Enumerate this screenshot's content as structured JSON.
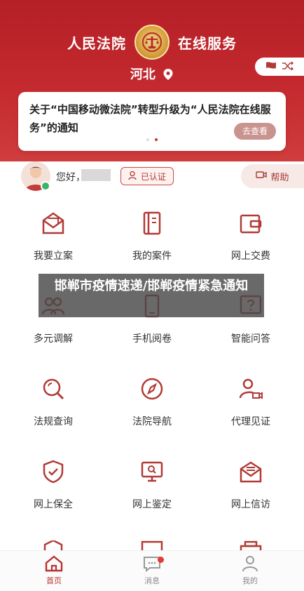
{
  "header": {
    "left_title": "人民法院",
    "right_title": "在线服务",
    "location": "河北",
    "emblem_icon": "court-emblem-icon",
    "switch_icons": [
      "flag-icon",
      "shuffle-icon"
    ]
  },
  "notice": {
    "text": "关于“中国移动微法院”转型升级为“人民法院在线服务”的通知",
    "button": "去查看",
    "pager_total": 2,
    "pager_active": 1
  },
  "user": {
    "greeting": "您好，",
    "auth_label": "已认证",
    "help_label": "帮助"
  },
  "grid": [
    {
      "label": "我要立案",
      "icon": "envelope-file-icon"
    },
    {
      "label": "我的案件",
      "icon": "folder-case-icon"
    },
    {
      "label": "网上交费",
      "icon": "wallet-icon"
    },
    {
      "label": "多元调解",
      "icon": "people-mediation-icon"
    },
    {
      "label": "手机阅卷",
      "icon": "phone-document-icon"
    },
    {
      "label": "智能问答",
      "icon": "question-bubble-icon"
    },
    {
      "label": "法规查询",
      "icon": "search-icon"
    },
    {
      "label": "法院导航",
      "icon": "compass-icon"
    },
    {
      "label": "代理见证",
      "icon": "agent-video-icon"
    },
    {
      "label": "网上保全",
      "icon": "shield-check-icon"
    },
    {
      "label": "网上鉴定",
      "icon": "monitor-search-icon"
    },
    {
      "label": "网上信访",
      "icon": "letter-icon"
    }
  ],
  "overlay_caption": "邯郸市疫情速递/邯郸疫情紧急通知",
  "tabbar": [
    {
      "label": "首页",
      "icon": "home-icon",
      "active": true
    },
    {
      "label": "消息",
      "icon": "message-icon",
      "active": false,
      "badge": true
    },
    {
      "label": "我的",
      "icon": "person-icon",
      "active": false
    }
  ],
  "colors": {
    "brand_red": "#b8312e",
    "header_red": "#c42a2f",
    "icon_red": "#b23a36",
    "verified_green": "#3bb36b"
  }
}
